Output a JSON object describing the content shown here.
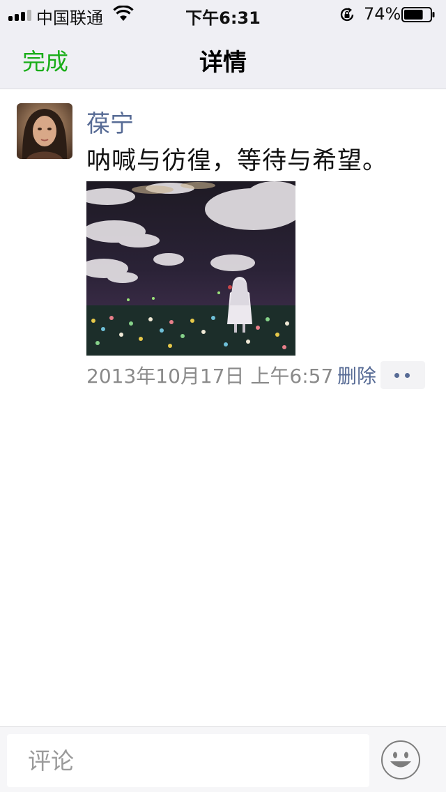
{
  "status_bar": {
    "carrier": "中国联通",
    "time": "下午6:31",
    "battery_percent": "74%",
    "battery_level": 0.74,
    "icons": [
      "signal-icon",
      "wifi-icon",
      "rotation-lock-icon",
      "battery-icon"
    ]
  },
  "nav": {
    "done_label": "完成",
    "title": "详情"
  },
  "post": {
    "author": "葆宁",
    "text": "呐喊与彷徨，等待与希望。",
    "photo_alt": "photo",
    "timestamp": "2013年10月17日 上午6:57",
    "delete_label": "删除",
    "more_icon": "more-dots-icon"
  },
  "comment_bar": {
    "placeholder": "评论",
    "value": "",
    "emoji_icon": "emoji-smiley-icon"
  },
  "colors": {
    "accent_green": "#1aad19",
    "link_blue": "#576b95",
    "bar_background": "#efeff4"
  }
}
